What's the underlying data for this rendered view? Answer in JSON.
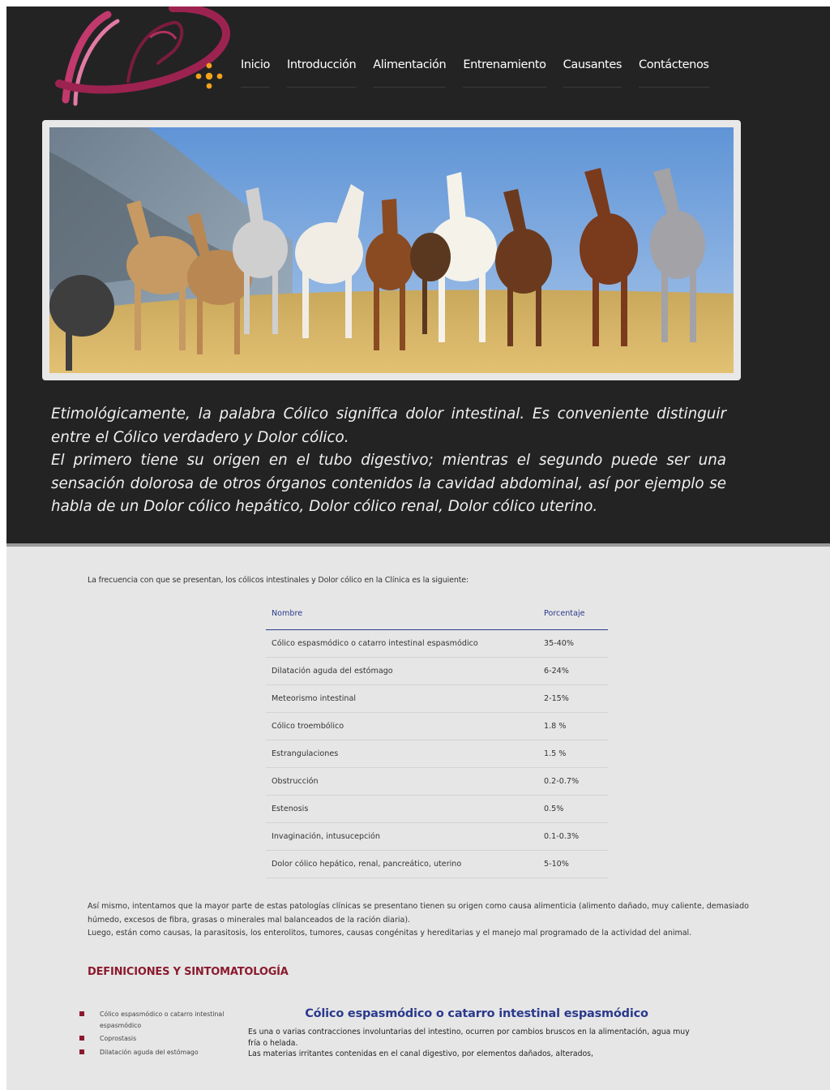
{
  "colors": {
    "header_bg": "#232323",
    "content_bg": "#e6e6e6",
    "accent_red": "#8b1a2e",
    "accent_blue": "#2b3a8c",
    "logo_pink": "#c2396e"
  },
  "nav": {
    "items": [
      {
        "label": "Inicio"
      },
      {
        "label": "Introducción"
      },
      {
        "label": "Alimentación"
      },
      {
        "label": "Entrenamiento"
      },
      {
        "label": "Causantes"
      },
      {
        "label": "Contáctenos"
      }
    ]
  },
  "hero": {
    "icon": "horses-photo"
  },
  "intro": {
    "p1": "Etimológicamente, la palabra Cólico significa dolor intestinal. Es conveniente distinguir entre el Cólico verdadero y Dolor cólico.",
    "p2": "El primero tiene su origen en el tubo digestivo; mientras el segundo puede ser una sensación dolorosa de otros órganos contenidos la cavidad abdominal, así por ejemplo se habla de un Dolor cólico hepático, Dolor cólico renal, Dolor cólico uterino."
  },
  "content": {
    "lead": "La frecuencia con que se presentan, los cólicos intestinales y Dolor cólico en la Clínica es la siguiente:",
    "table": {
      "headers": [
        "Nombre",
        "Porcentaje"
      ],
      "rows": [
        [
          "Cólico espasmódico o catarro intestinal espasmódico",
          "35-40%"
        ],
        [
          "Dilatación aguda del estómago",
          "6-24%"
        ],
        [
          "Meteorismo intestinal",
          "2-15%"
        ],
        [
          "Cólico troembólico",
          "1.8 %"
        ],
        [
          "Estrangulaciones",
          "1.5 %"
        ],
        [
          "Obstrucción",
          "0.2-0.7%"
        ],
        [
          "Estenosis",
          "0.5%"
        ],
        [
          "Invaginación, intusucepción",
          "0.1-0.3%"
        ],
        [
          "Dolor cólico hepático, renal, pancreático, uterino",
          "5-10%"
        ]
      ]
    },
    "para2_line1": "Así mismo, intentamos que la mayor parte de estas patologías clínicas se presentano tienen su origen como causa alimenticia (alimento dañado, muy caliente, demasiado húmedo, excesos de fibra, grasas o minerales mal balanceados de la ración diaria).",
    "para2_line2": "Luego, están como causas, la parasitosis, los enterolitos, tumores, causas congénitas y hereditarias y el manejo mal programado de la actividad del animal.",
    "section_title": "DEFINICIONES Y SINTOMATOLOGÍA",
    "side_list": [
      "Cólico espasmódico o catarro intestinal espasmódico",
      "Coprostasis",
      "Dilatación aguda del estómago"
    ],
    "def_title": "Cólico espasmódico o catarro intestinal espasmódico",
    "def_line1": "Es una o varias contracciones involuntarias del intestino, ocurren por cambios bruscos en la alimentación, agua muy fría o helada.",
    "def_line2": "Las materias irritantes contenidas en el canal digestivo, por elementos dañados, alterados,"
  }
}
